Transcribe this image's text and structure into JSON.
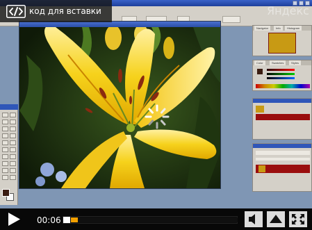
{
  "embed": {
    "label": "код для вставки",
    "icon": "code-brackets-icon"
  },
  "watermark": {
    "text": "Яндекс"
  },
  "controls": {
    "current_time": "00:06",
    "progress_fraction": 0.04,
    "accent_color": "#f2a000",
    "icons": {
      "play": "play-icon",
      "volume": "speaker-icon",
      "upload": "upload-icon",
      "fullscreen": "fullscreen-icon"
    }
  },
  "video": {
    "app": "Adobe Photoshop",
    "loading_indicator": "loading-spinner-icon"
  }
}
